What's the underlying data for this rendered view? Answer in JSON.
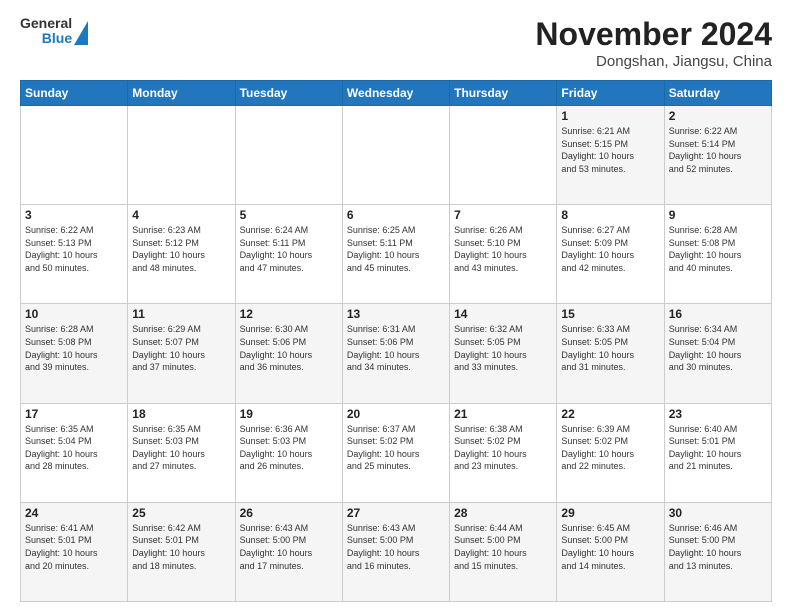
{
  "header": {
    "logo_line1": "General",
    "logo_line2": "Blue",
    "title": "November 2024",
    "subtitle": "Dongshan, Jiangsu, China"
  },
  "weekdays": [
    "Sunday",
    "Monday",
    "Tuesday",
    "Wednesday",
    "Thursday",
    "Friday",
    "Saturday"
  ],
  "weeks": [
    [
      {
        "day": "",
        "info": ""
      },
      {
        "day": "",
        "info": ""
      },
      {
        "day": "",
        "info": ""
      },
      {
        "day": "",
        "info": ""
      },
      {
        "day": "",
        "info": ""
      },
      {
        "day": "1",
        "info": "Sunrise: 6:21 AM\nSunset: 5:15 PM\nDaylight: 10 hours\nand 53 minutes."
      },
      {
        "day": "2",
        "info": "Sunrise: 6:22 AM\nSunset: 5:14 PM\nDaylight: 10 hours\nand 52 minutes."
      }
    ],
    [
      {
        "day": "3",
        "info": "Sunrise: 6:22 AM\nSunset: 5:13 PM\nDaylight: 10 hours\nand 50 minutes."
      },
      {
        "day": "4",
        "info": "Sunrise: 6:23 AM\nSunset: 5:12 PM\nDaylight: 10 hours\nand 48 minutes."
      },
      {
        "day": "5",
        "info": "Sunrise: 6:24 AM\nSunset: 5:11 PM\nDaylight: 10 hours\nand 47 minutes."
      },
      {
        "day": "6",
        "info": "Sunrise: 6:25 AM\nSunset: 5:11 PM\nDaylight: 10 hours\nand 45 minutes."
      },
      {
        "day": "7",
        "info": "Sunrise: 6:26 AM\nSunset: 5:10 PM\nDaylight: 10 hours\nand 43 minutes."
      },
      {
        "day": "8",
        "info": "Sunrise: 6:27 AM\nSunset: 5:09 PM\nDaylight: 10 hours\nand 42 minutes."
      },
      {
        "day": "9",
        "info": "Sunrise: 6:28 AM\nSunset: 5:08 PM\nDaylight: 10 hours\nand 40 minutes."
      }
    ],
    [
      {
        "day": "10",
        "info": "Sunrise: 6:28 AM\nSunset: 5:08 PM\nDaylight: 10 hours\nand 39 minutes."
      },
      {
        "day": "11",
        "info": "Sunrise: 6:29 AM\nSunset: 5:07 PM\nDaylight: 10 hours\nand 37 minutes."
      },
      {
        "day": "12",
        "info": "Sunrise: 6:30 AM\nSunset: 5:06 PM\nDaylight: 10 hours\nand 36 minutes."
      },
      {
        "day": "13",
        "info": "Sunrise: 6:31 AM\nSunset: 5:06 PM\nDaylight: 10 hours\nand 34 minutes."
      },
      {
        "day": "14",
        "info": "Sunrise: 6:32 AM\nSunset: 5:05 PM\nDaylight: 10 hours\nand 33 minutes."
      },
      {
        "day": "15",
        "info": "Sunrise: 6:33 AM\nSunset: 5:05 PM\nDaylight: 10 hours\nand 31 minutes."
      },
      {
        "day": "16",
        "info": "Sunrise: 6:34 AM\nSunset: 5:04 PM\nDaylight: 10 hours\nand 30 minutes."
      }
    ],
    [
      {
        "day": "17",
        "info": "Sunrise: 6:35 AM\nSunset: 5:04 PM\nDaylight: 10 hours\nand 28 minutes."
      },
      {
        "day": "18",
        "info": "Sunrise: 6:35 AM\nSunset: 5:03 PM\nDaylight: 10 hours\nand 27 minutes."
      },
      {
        "day": "19",
        "info": "Sunrise: 6:36 AM\nSunset: 5:03 PM\nDaylight: 10 hours\nand 26 minutes."
      },
      {
        "day": "20",
        "info": "Sunrise: 6:37 AM\nSunset: 5:02 PM\nDaylight: 10 hours\nand 25 minutes."
      },
      {
        "day": "21",
        "info": "Sunrise: 6:38 AM\nSunset: 5:02 PM\nDaylight: 10 hours\nand 23 minutes."
      },
      {
        "day": "22",
        "info": "Sunrise: 6:39 AM\nSunset: 5:02 PM\nDaylight: 10 hours\nand 22 minutes."
      },
      {
        "day": "23",
        "info": "Sunrise: 6:40 AM\nSunset: 5:01 PM\nDaylight: 10 hours\nand 21 minutes."
      }
    ],
    [
      {
        "day": "24",
        "info": "Sunrise: 6:41 AM\nSunset: 5:01 PM\nDaylight: 10 hours\nand 20 minutes."
      },
      {
        "day": "25",
        "info": "Sunrise: 6:42 AM\nSunset: 5:01 PM\nDaylight: 10 hours\nand 18 minutes."
      },
      {
        "day": "26",
        "info": "Sunrise: 6:43 AM\nSunset: 5:00 PM\nDaylight: 10 hours\nand 17 minutes."
      },
      {
        "day": "27",
        "info": "Sunrise: 6:43 AM\nSunset: 5:00 PM\nDaylight: 10 hours\nand 16 minutes."
      },
      {
        "day": "28",
        "info": "Sunrise: 6:44 AM\nSunset: 5:00 PM\nDaylight: 10 hours\nand 15 minutes."
      },
      {
        "day": "29",
        "info": "Sunrise: 6:45 AM\nSunset: 5:00 PM\nDaylight: 10 hours\nand 14 minutes."
      },
      {
        "day": "30",
        "info": "Sunrise: 6:46 AM\nSunset: 5:00 PM\nDaylight: 10 hours\nand 13 minutes."
      }
    ]
  ]
}
